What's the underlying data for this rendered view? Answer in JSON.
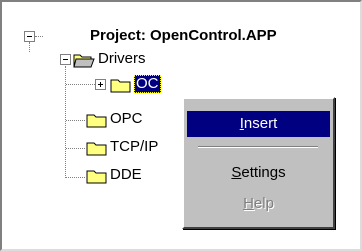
{
  "tree": {
    "root_label": "Project: OpenControl.APP",
    "drivers_label": "Drivers",
    "selected_label": "OC",
    "children": [
      {
        "label": "OPC"
      },
      {
        "label": "TCP/IP"
      },
      {
        "label": "DDE"
      }
    ]
  },
  "context_menu": {
    "items": [
      {
        "label": "Insert",
        "mnemonic": "I",
        "rest": "nsert",
        "state": "highlighted"
      },
      {
        "label": "Settings",
        "mnemonic": "S",
        "rest": "ettings",
        "state": "enabled"
      },
      {
        "label": "Help",
        "mnemonic": "H",
        "rest": "elp",
        "state": "disabled"
      }
    ]
  },
  "colors": {
    "selection": "#000080",
    "folder_fill": "#ffff80",
    "folder_outline": "#000000",
    "menu_face": "#c0c0c0"
  },
  "icons": [
    "expander-minus-icon",
    "expander-plus-icon",
    "folder-icon",
    "open-folder-icon"
  ]
}
